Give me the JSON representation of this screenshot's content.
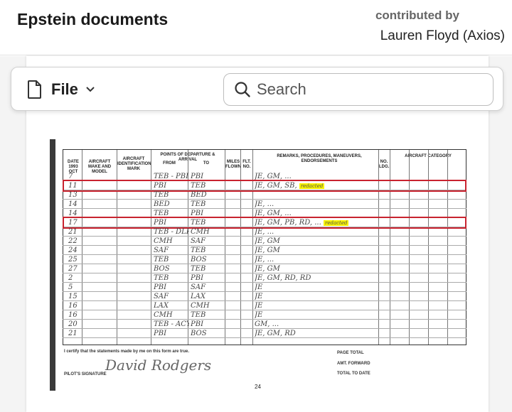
{
  "header": {
    "title": "Epstein documents",
    "contributed_label": "contributed by",
    "contributor": "Lauren Floyd (Axios)"
  },
  "toolbar": {
    "file_label": "File",
    "search_placeholder": "Search"
  },
  "logbook": {
    "headers": {
      "date": "DATE 1993 OCT",
      "aircraft": "AIRCRAFT MAKE AND MODEL",
      "ident": "AIRCRAFT IDENTIFICATION MARK",
      "points": "POINTS OF DEPARTURE & ARRIVAL",
      "from": "FROM",
      "to": "TO",
      "miles": "MILES FLOWN",
      "flt": "FLT. NO.",
      "remarks": "REMARKS, PROCEDURES, MANEUVERS, ENDORSEMENTS",
      "nolog": "NO. LDG.",
      "category": "AIRCRAFT CATEGORY"
    },
    "rows": [
      {
        "date": "7",
        "from": "TEB - PBI",
        "to": "PBI",
        "remarks": "JE, GM, ..."
      },
      {
        "date": "11",
        "from": "PBI",
        "to": "TEB",
        "remarks": "JE, GM, SB,",
        "highlight": "redacted",
        "box": true
      },
      {
        "date": "13",
        "from": "TEB",
        "to": "BED",
        "remarks": ""
      },
      {
        "date": "14",
        "from": "BED",
        "to": "TEB",
        "remarks": "JE, ..."
      },
      {
        "date": "14",
        "from": "TEB",
        "to": "PBI",
        "remarks": "JE, GM, ..."
      },
      {
        "date": "17",
        "from": "PBI",
        "to": "TEB",
        "remarks": "JE, GM, PB, RD, ...",
        "highlight": "redacted",
        "box": true
      },
      {
        "date": "21",
        "from": "TEB - DLP",
        "to": "CMH",
        "remarks": "JE, ..."
      },
      {
        "date": "22",
        "from": "CMH",
        "to": "SAF",
        "remarks": "JE, GM"
      },
      {
        "date": "24",
        "from": "SAF",
        "to": "TEB",
        "remarks": "JE, GM"
      },
      {
        "date": "25",
        "from": "TEB",
        "to": "BOS",
        "remarks": "JE, ..."
      },
      {
        "date": "27",
        "from": "BOS",
        "to": "TEB",
        "remarks": "JE, GM"
      },
      {
        "date": "2",
        "from": "TEB",
        "to": "PBI",
        "remarks": "JE, GM, RD, RD"
      },
      {
        "date": "5",
        "from": "PBI",
        "to": "SAF",
        "remarks": "JE"
      },
      {
        "date": "15",
        "from": "SAF",
        "to": "LAX",
        "remarks": "JE"
      },
      {
        "date": "16",
        "from": "LAX",
        "to": "CMH",
        "remarks": "JE"
      },
      {
        "date": "16",
        "from": "CMH",
        "to": "TEB",
        "remarks": "JE"
      },
      {
        "date": "20",
        "from": "TEB - ACY",
        "to": "PBI",
        "remarks": "GM, ..."
      },
      {
        "date": "21",
        "from": "PBI",
        "to": "BOS",
        "remarks": "JE, GM, RD"
      }
    ],
    "certify": "I certify that the statements made by me on this form are true.",
    "signature_label": "PILOT'S SIGNATURE",
    "page_total": "PAGE TOTAL",
    "amt_forward": "AMT. FORWARD",
    "total_to_date": "TOTAL TO DATE",
    "page_number": "24"
  },
  "colors": {
    "redbox": "#c8232f",
    "highlight": "#f7f200"
  }
}
